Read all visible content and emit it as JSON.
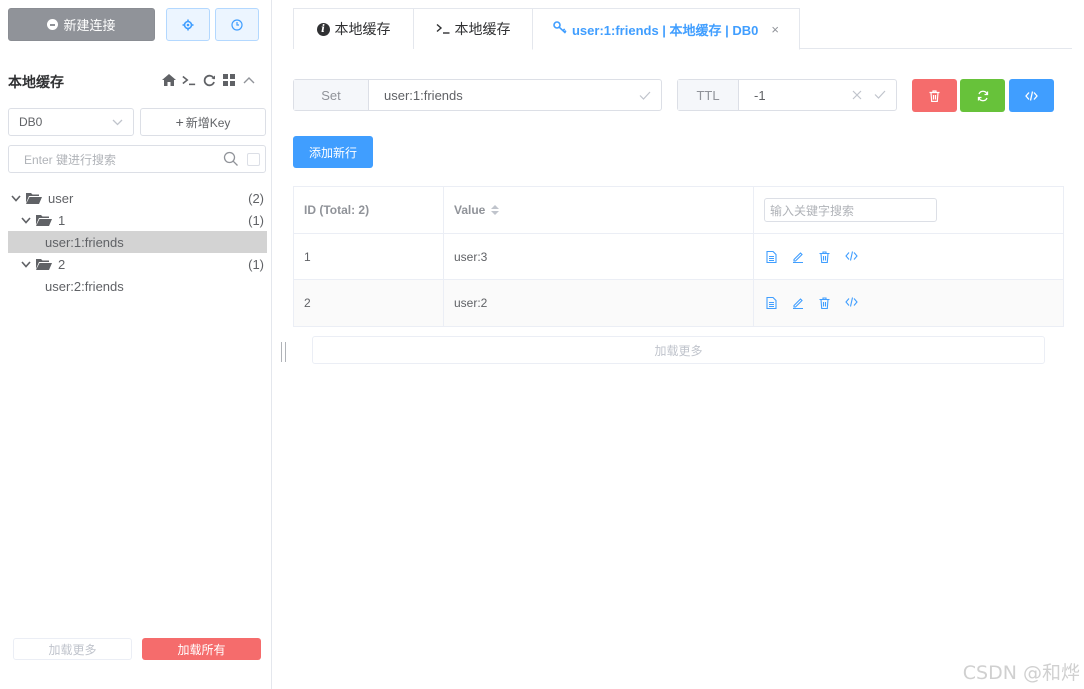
{
  "sidebar": {
    "new_connection_label": "新建连接",
    "title": "本地缓存",
    "db_select_value": "DB0",
    "add_key_label": "新增Key",
    "search_placeholder": "Enter 键进行搜索",
    "tree": [
      {
        "label": "user",
        "count": "(2)"
      },
      {
        "label": "1",
        "count": "(1)"
      },
      {
        "label": "user:1:friends"
      },
      {
        "label": "2",
        "count": "(1)"
      },
      {
        "label": "user:2:friends"
      }
    ],
    "load_more_label": "加载更多",
    "load_all_label": "加载所有"
  },
  "tabs": [
    {
      "label": "本地缓存",
      "icon": "info-icon"
    },
    {
      "label": "本地缓存",
      "icon": "terminal-icon"
    },
    {
      "label": "user:1:friends | 本地缓存 | DB0",
      "icon": "key-icon",
      "active": true
    }
  ],
  "key_header": {
    "type_label": "Set",
    "key_name": "user:1:friends",
    "ttl_label": "TTL",
    "ttl_value": "-1"
  },
  "add_row_label": "添加新行",
  "table": {
    "col_id": "ID (Total: 2)",
    "col_value": "Value",
    "search_placeholder": "输入关键字搜索",
    "rows": [
      {
        "id": "1",
        "value": "user:3"
      },
      {
        "id": "2",
        "value": "user:2"
      }
    ]
  },
  "load_more_label": "加载更多",
  "watermark": "CSDN @和烨",
  "colors": {
    "primary": "#409eff",
    "danger": "#f56c6c",
    "success": "#67c23a",
    "info": "#909399"
  }
}
